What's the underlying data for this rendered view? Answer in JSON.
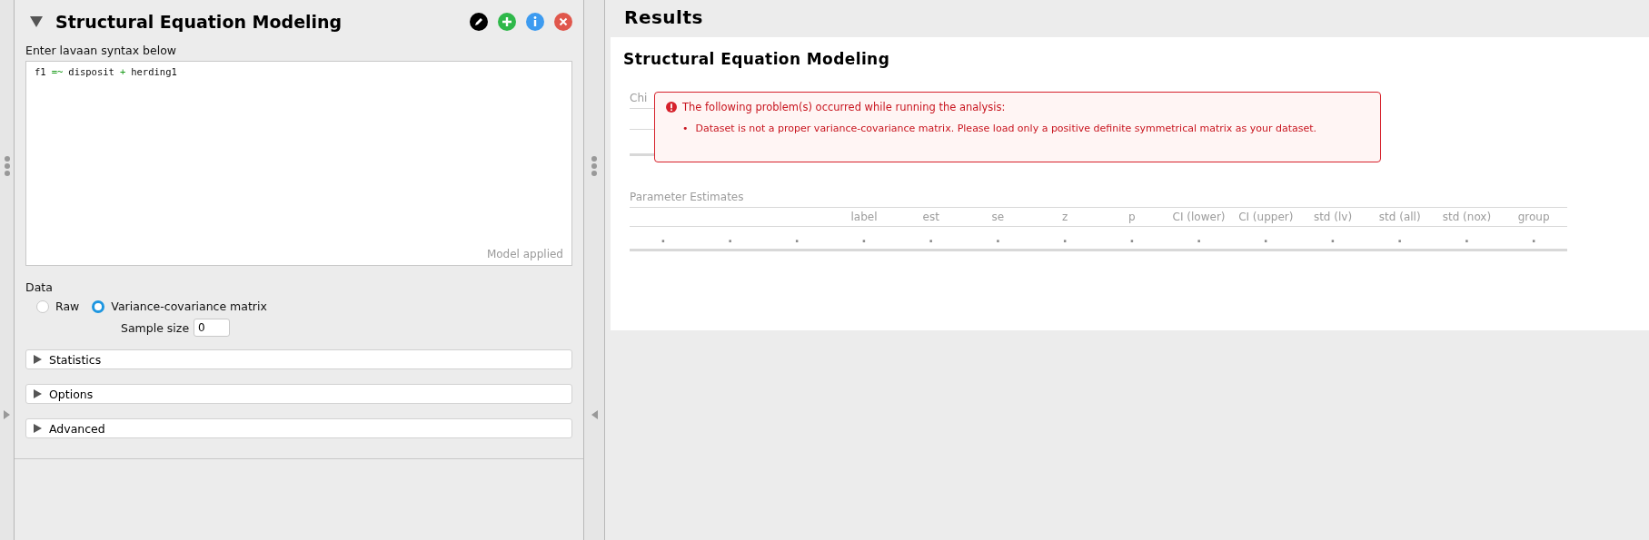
{
  "analysis_panel": {
    "title": "Structural Equation Modeling",
    "expanded": true,
    "syntax": {
      "label": "Enter lavaan syntax below",
      "code": [
        {
          "kind": "name",
          "text": "f1"
        },
        {
          "kind": "op",
          "text": "=~"
        },
        {
          "kind": "name",
          "text": "disposit"
        },
        {
          "kind": "op",
          "text": "+"
        },
        {
          "kind": "name",
          "text": "herding1"
        }
      ],
      "status": "Model applied"
    },
    "data": {
      "label": "Data",
      "options": [
        {
          "label": "Raw",
          "selected": false
        },
        {
          "label": "Variance-covariance matrix",
          "selected": true
        }
      ],
      "sample_size": {
        "label": "Sample size",
        "value": "0"
      }
    },
    "sections": [
      {
        "label": "Statistics",
        "expanded": false
      },
      {
        "label": "Options",
        "expanded": false
      },
      {
        "label": "Advanced",
        "expanded": false
      }
    ]
  },
  "results": {
    "title": "Results",
    "heading": "Structural Equation Modeling",
    "chi_table": {
      "title": "Chi"
    },
    "error": {
      "title": "The following problem(s) occurred while running the analysis:",
      "items": [
        {
          "marker": "•",
          "text": "Dataset is not a proper variance-covariance matrix. Please load only a positive definite symmetrical matrix as your dataset."
        }
      ]
    },
    "parameter_table": {
      "title": "Parameter Estimates",
      "columns": [
        {},
        {},
        {},
        {
          "header": "label"
        },
        {
          "header": "est"
        },
        {
          "header": "se"
        },
        {
          "header": "z"
        },
        {
          "header": "p"
        },
        {
          "header": "CI (lower)"
        },
        {
          "header": "CI (upper)"
        },
        {
          "header": "std (lv)"
        },
        {
          "header": "std (all)"
        },
        {
          "header": "std (nox)"
        },
        {
          "header": "group"
        }
      ],
      "rows": [
        [
          ".",
          ".",
          ".",
          ".",
          ".",
          ".",
          ".",
          ".",
          ".",
          ".",
          ".",
          ".",
          ".",
          "."
        ]
      ]
    }
  }
}
